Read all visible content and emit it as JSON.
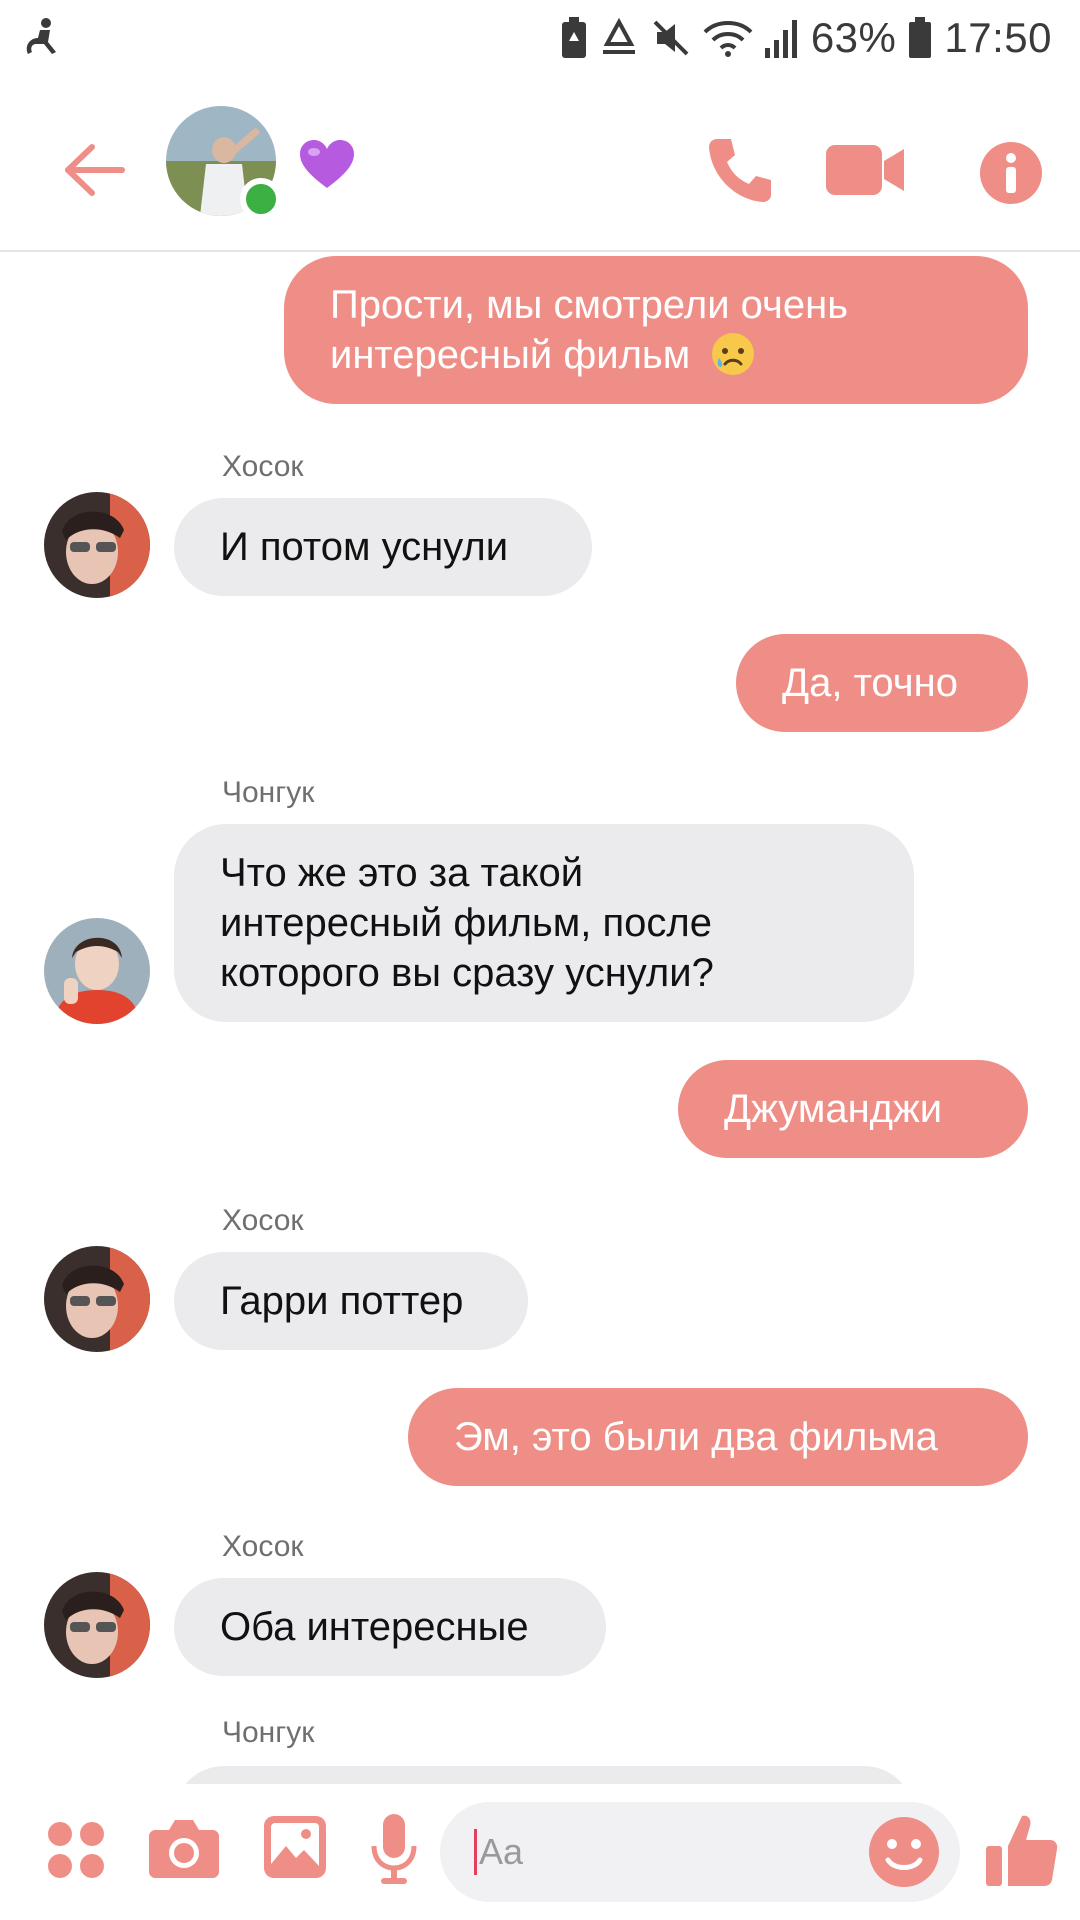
{
  "status_bar": {
    "battery_percent": "63%",
    "time": "17:50"
  },
  "header": {
    "icons": [
      "back-arrow-icon",
      "purple-heart-icon",
      "phone-icon",
      "video-camera-icon",
      "info-icon"
    ],
    "online": true
  },
  "messages": [
    {
      "direction": "out",
      "lines": [
        "Прости, мы смотрели очень",
        "интересный фильм"
      ],
      "emoji": "sad-tear-face-emoji"
    },
    {
      "direction": "in",
      "sender": "Хосок",
      "lines": [
        "И потом уснули"
      ]
    },
    {
      "direction": "out",
      "lines": [
        "Да, точно"
      ]
    },
    {
      "direction": "in",
      "sender": "Чонгук",
      "lines": [
        "Что же это за такой",
        "интересный фильм, после",
        "которого вы сразу уснули?"
      ]
    },
    {
      "direction": "out",
      "lines": [
        "Джуманджи"
      ]
    },
    {
      "direction": "in",
      "sender": "Хосок",
      "lines": [
        "Гарри поттер"
      ]
    },
    {
      "direction": "out",
      "lines": [
        "Эм, это были два фильма"
      ]
    },
    {
      "direction": "in",
      "sender": "Хосок",
      "lines": [
        "Оба интересные"
      ]
    },
    {
      "direction": "in",
      "sender": "Чонгук",
      "lines": []
    }
  ],
  "composer": {
    "placeholder": "Aa",
    "icons": [
      "apps-grid-icon",
      "camera-icon",
      "gallery-icon",
      "microphone-icon",
      "emoji-icon",
      "thumbs-up-icon"
    ]
  },
  "colors": {
    "accent": "#ef8e86",
    "incoming_bubble": "#ebebee",
    "online_dot": "#3cb043"
  }
}
